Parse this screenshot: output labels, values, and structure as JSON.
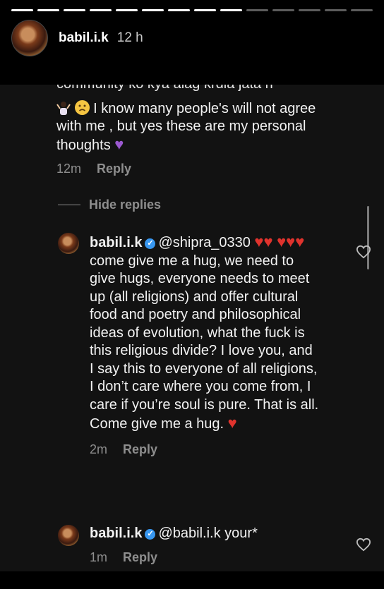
{
  "story": {
    "progress_segments_total": 14,
    "progress_segments_viewed": 9,
    "username": "babil.i.k",
    "time": "12 h"
  },
  "comment": {
    "cut_text": "community ko kya alag krdia jata h",
    "text": "I know many people's will not agree with me , but yes these are my personal thoughts",
    "time": "12m",
    "reply_label": "Reply"
  },
  "hide_replies_label": "Hide replies",
  "replies": [
    {
      "username": "babil.i.k",
      "mention": "@shipra_0330",
      "text": "come give me a hug, we need to give hugs, everyone needs to meet up (all religions) and offer cultural food and poetry and philosophical ideas of evolution, what the fuck is this religious divide? I love you, and I say this to everyone of all religions, I don’t care where you come from, I care if you’re soul is pure. That is all. Come give me a hug.",
      "time": "2m",
      "reply_label": "Reply"
    },
    {
      "username": "babil.i.k",
      "mention": "@babil.i.k",
      "text": "your*",
      "time": "1m",
      "reply_label": "Reply"
    }
  ],
  "colors": {
    "background": "#000000",
    "card": "#121212",
    "muted": "#8e8e8e",
    "verified": "#3897f0",
    "heart_emoji": "#e0332d",
    "purple_heart": "#9b59d0"
  }
}
